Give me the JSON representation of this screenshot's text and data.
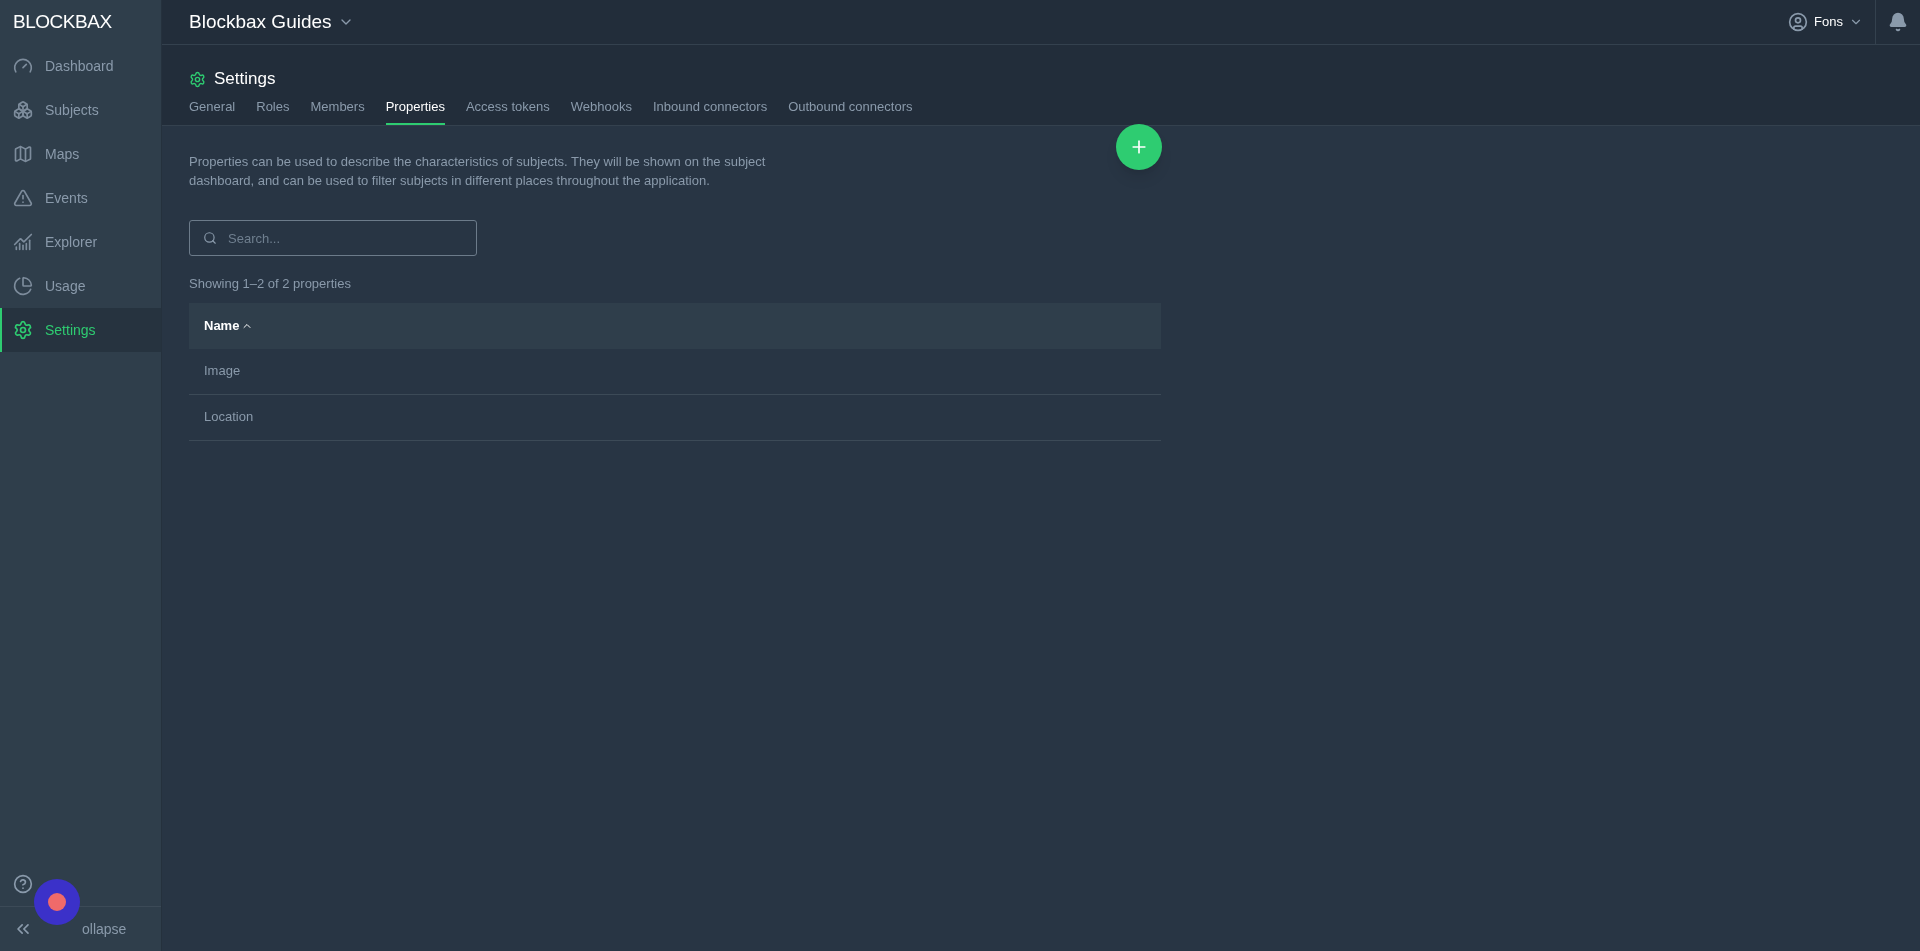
{
  "logo": {
    "text": "BLOCKBAX"
  },
  "header": {
    "project": "Blockbax Guides",
    "user": "Fons"
  },
  "sidebar": {
    "items": [
      {
        "label": "Dashboard",
        "selected": false
      },
      {
        "label": "Subjects",
        "selected": false
      },
      {
        "label": "Maps",
        "selected": false
      },
      {
        "label": "Events",
        "selected": false
      },
      {
        "label": "Explorer",
        "selected": false
      },
      {
        "label": "Usage",
        "selected": false
      },
      {
        "label": "Settings",
        "selected": true
      }
    ],
    "collapse": "ollapse"
  },
  "page": {
    "title": "Settings",
    "tabs": [
      {
        "label": "General",
        "selected": false
      },
      {
        "label": "Roles",
        "selected": false
      },
      {
        "label": "Members",
        "selected": false
      },
      {
        "label": "Properties",
        "selected": true
      },
      {
        "label": "Access tokens",
        "selected": false
      },
      {
        "label": "Webhooks",
        "selected": false
      },
      {
        "label": "Inbound connectors",
        "selected": false
      },
      {
        "label": "Outbound connectors",
        "selected": false
      }
    ],
    "description": "Properties can be used to describe the characteristics of subjects. They will be shown on the subject dashboard, and can be used to filter subjects in different places throughout the application.",
    "search": {
      "placeholder": "Search..."
    },
    "count": "Showing 1–2 of 2 properties",
    "table": {
      "columns": [
        {
          "label": "Name"
        }
      ],
      "rows": [
        {
          "name": "Image"
        },
        {
          "name": "Location"
        }
      ]
    }
  }
}
